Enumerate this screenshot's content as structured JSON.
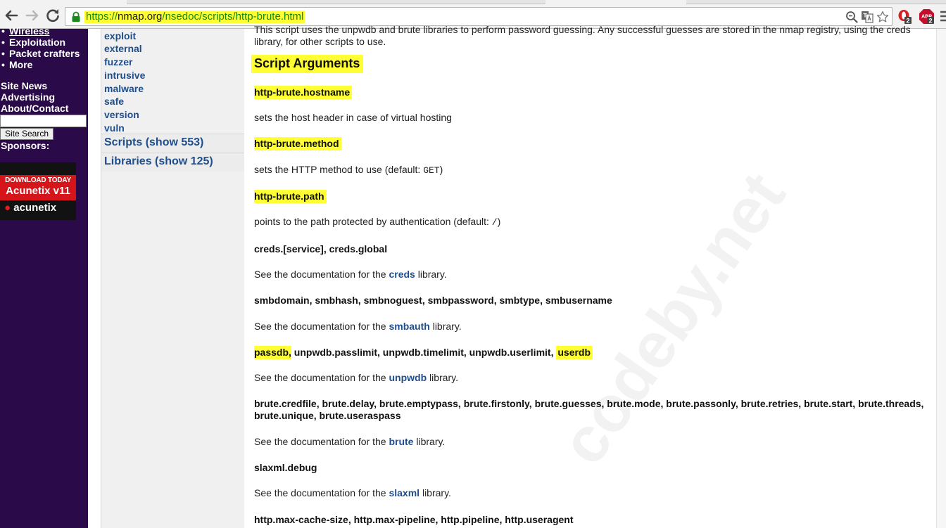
{
  "browser": {
    "url_scheme": "https://",
    "url_host": "nmap.org",
    "url_path": "/nsedoc/scripts/http-brute.html",
    "ext_badge_1": "2",
    "ext_badge_2": "2"
  },
  "sidebar": {
    "items": [
      "Wireless",
      "Exploitation",
      "Packet crafters",
      "More"
    ],
    "links": [
      "Site News",
      "Advertising",
      "About/Contact"
    ],
    "search_button": "Site Search",
    "sponsors_label": "Sponsors:",
    "ad": {
      "line1": "DOWNLOAD TODAY",
      "line2": "Acunetix v11",
      "brand": "acunetix"
    }
  },
  "categories": {
    "items": [
      "exploit",
      "external",
      "fuzzer",
      "intrusive",
      "malware",
      "safe",
      "version",
      "vuln"
    ],
    "scripts_toggle": "Scripts (show 553)",
    "libraries_toggle": "Libraries (show 125)"
  },
  "content": {
    "intro_line1": "This script uses the unpwdb and brute libraries to perform password guessing. Any successful guesses are stored in the nmap registry, using the creds",
    "intro_line2": "library, for other scripts to use.",
    "section_title": "Script Arguments",
    "args": {
      "hostname": {
        "name": "http-brute.hostname",
        "desc": "sets the host header in case of virtual hosting"
      },
      "method": {
        "name": "http-brute.method",
        "desc": "sets the HTTP method to use (default: ",
        "default": "GET",
        "desc_end": ")"
      },
      "path": {
        "name": "http-brute.path",
        "desc": "points to the path protected by authentication (default: ",
        "default": "/",
        "desc_end": ")"
      },
      "creds": {
        "name": "creds.[service], creds.global",
        "pre": "See the documentation for the ",
        "lib": "creds",
        "post": " library."
      },
      "smb": {
        "name": "smbdomain, smbhash, smbnoguest, smbpassword, smbtype, smbusername",
        "pre": "See the documentation for the ",
        "lib": "smbauth",
        "post": " library."
      },
      "unpwdb": {
        "name_a": "passdb,",
        "name_b": " unpwdb.passlimit, unpwdb.timelimit, unpwdb.userlimit, ",
        "name_c": "userdb",
        "pre": "See the documentation for the ",
        "lib": "unpwdb",
        "post": " library."
      },
      "brute": {
        "name": "brute.credfile, brute.delay, brute.emptypass, brute.firstonly, brute.guesses, brute.mode, brute.passonly, brute.retries, brute.start, brute.threads, brute.unique, brute.useraspass",
        "pre": "See the documentation for the ",
        "lib": "brute",
        "post": " library."
      },
      "slaxml": {
        "name": "slaxml.debug",
        "pre": "See the documentation for the ",
        "lib": "slaxml",
        "post": " library."
      },
      "http": {
        "name": "http.max-cache-size, http.max-pipeline, http.pipeline, http.useragent"
      }
    }
  },
  "watermark": "codeby.net",
  "colors": {
    "highlight": "#ffff33",
    "sidebar_bg": "#2b0a49",
    "link": "#1f4e8c",
    "url_green": "#138a13"
  }
}
